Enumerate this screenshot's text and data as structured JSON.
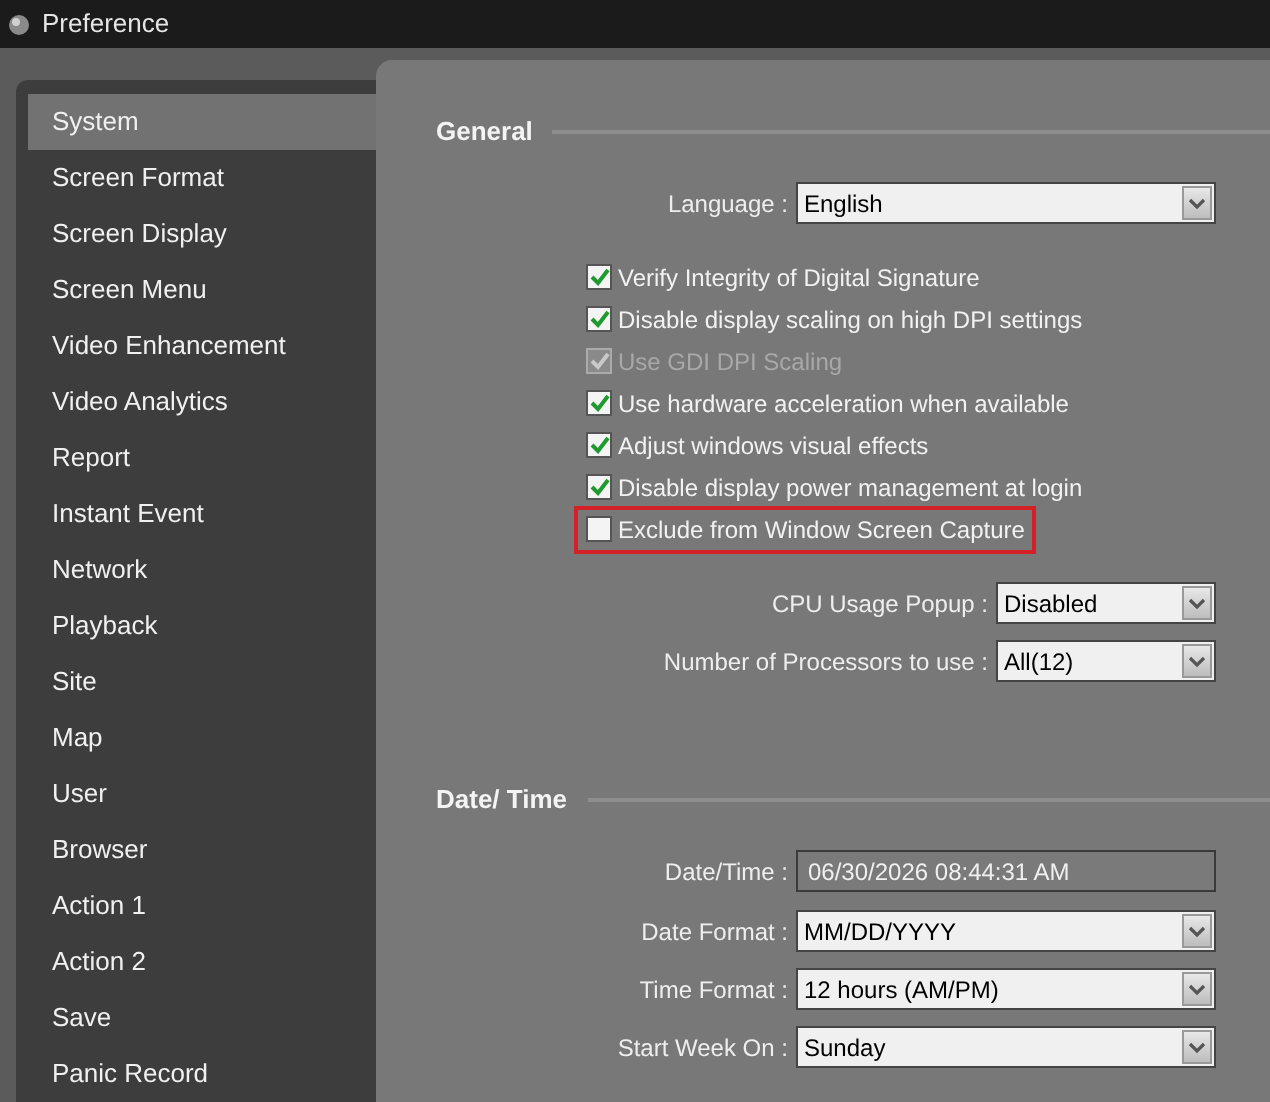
{
  "window": {
    "title": "Preference"
  },
  "sidebar": {
    "items": [
      {
        "label": "System",
        "selected": true
      },
      {
        "label": "Screen Format",
        "selected": false
      },
      {
        "label": "Screen Display",
        "selected": false
      },
      {
        "label": "Screen Menu",
        "selected": false
      },
      {
        "label": "Video Enhancement",
        "selected": false
      },
      {
        "label": "Video Analytics",
        "selected": false
      },
      {
        "label": "Report",
        "selected": false
      },
      {
        "label": "Instant Event",
        "selected": false
      },
      {
        "label": "Network",
        "selected": false
      },
      {
        "label": "Playback",
        "selected": false
      },
      {
        "label": "Site",
        "selected": false
      },
      {
        "label": "Map",
        "selected": false
      },
      {
        "label": "User",
        "selected": false
      },
      {
        "label": "Browser",
        "selected": false
      },
      {
        "label": "Action 1",
        "selected": false
      },
      {
        "label": "Action 2",
        "selected": false
      },
      {
        "label": "Save",
        "selected": false
      },
      {
        "label": "Panic Record",
        "selected": false
      }
    ]
  },
  "sections": [
    {
      "title": "General",
      "rows": [
        {
          "kind": "select",
          "label": "Language :",
          "value": "English"
        },
        {
          "kind": "checkbox",
          "label": "Verify Integrity of Digital Signature",
          "checked": true,
          "disabled": false,
          "highlighted": false
        },
        {
          "kind": "checkbox",
          "label": "Disable display scaling on high DPI settings",
          "checked": true,
          "disabled": false,
          "highlighted": false
        },
        {
          "kind": "checkbox",
          "label": "Use GDI DPI Scaling",
          "checked": true,
          "disabled": true,
          "highlighted": false
        },
        {
          "kind": "checkbox",
          "label": "Use hardware acceleration when available",
          "checked": true,
          "disabled": false,
          "highlighted": false
        },
        {
          "kind": "checkbox",
          "label": "Adjust windows visual effects",
          "checked": true,
          "disabled": false,
          "highlighted": false
        },
        {
          "kind": "checkbox",
          "label": "Disable display power management at login",
          "checked": true,
          "disabled": false,
          "highlighted": false
        },
        {
          "kind": "checkbox",
          "label": "Exclude from Window Screen Capture",
          "checked": false,
          "disabled": false,
          "highlighted": true
        },
        {
          "kind": "select",
          "label": "CPU Usage Popup :",
          "value": "Disabled"
        },
        {
          "kind": "select",
          "label": "Number of Processors to use :",
          "value": "All(12)"
        }
      ]
    },
    {
      "title": "Date/ Time",
      "rows": [
        {
          "kind": "readonly",
          "label": "Date/Time :",
          "value": "06/30/2026 08:44:31 AM"
        },
        {
          "kind": "select",
          "label": "Date Format :",
          "value": "MM/DD/YYYY"
        },
        {
          "kind": "select",
          "label": "Time Format :",
          "value": "12 hours (AM/PM)"
        },
        {
          "kind": "select",
          "label": "Start Week On :",
          "value": "Sunday"
        }
      ]
    }
  ]
}
